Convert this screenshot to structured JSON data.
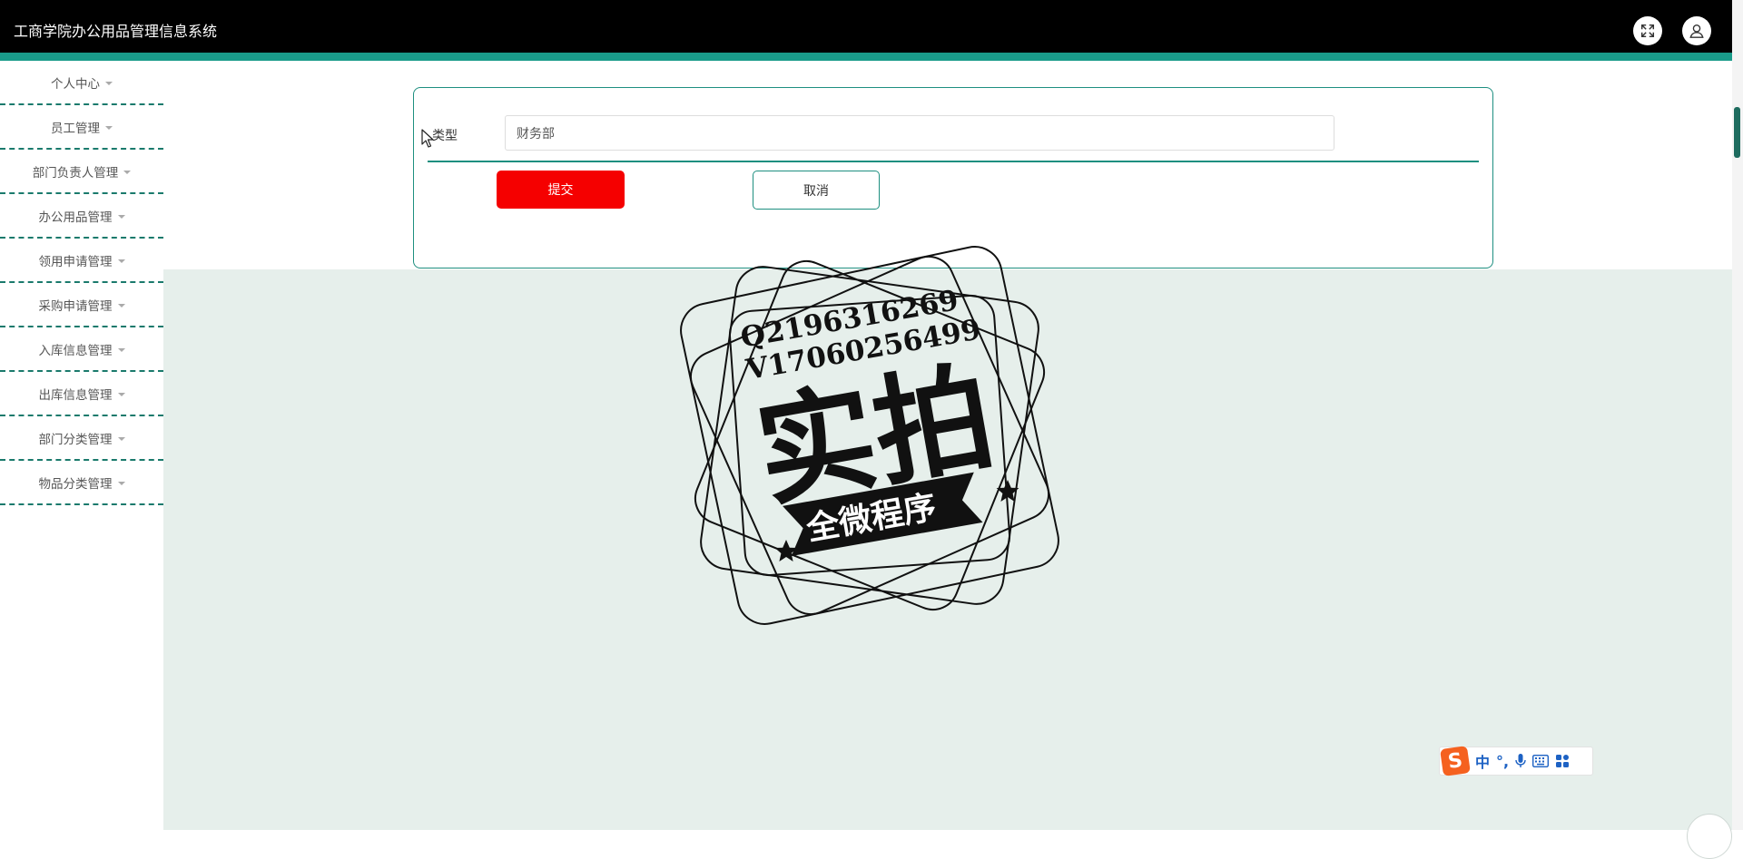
{
  "header": {
    "title": "工商学院办公用品管理信息系统",
    "icons": [
      "fullscreen-icon",
      "user-icon"
    ]
  },
  "sidebar": {
    "items": [
      {
        "label": "个人中心"
      },
      {
        "label": "员工管理"
      },
      {
        "label": "部门负责人管理"
      },
      {
        "label": "办公用品管理"
      },
      {
        "label": "领用申请管理"
      },
      {
        "label": "采购申请管理"
      },
      {
        "label": "入库信息管理"
      },
      {
        "label": "出库信息管理"
      },
      {
        "label": "部门分类管理"
      },
      {
        "label": "物品分类管理"
      }
    ]
  },
  "form": {
    "type_label": "类型",
    "type_value": "财务部",
    "submit_label": "提交",
    "cancel_label": "取消"
  },
  "watermark": {
    "line1": "Q2196316269",
    "line2": "V17060256499",
    "main": "实拍",
    "banner": "全微程序"
  },
  "ime": {
    "logo": "S",
    "mode": "中",
    "punct": "°,",
    "icons": [
      "microphone-icon",
      "keyboard-icon",
      "grid-icon"
    ]
  },
  "colors": {
    "header_bg": "#000000",
    "accent": "#199b8a",
    "submit": "#f50000",
    "content_bg": "#e6efeb",
    "ime_logo": "#f5611f"
  }
}
